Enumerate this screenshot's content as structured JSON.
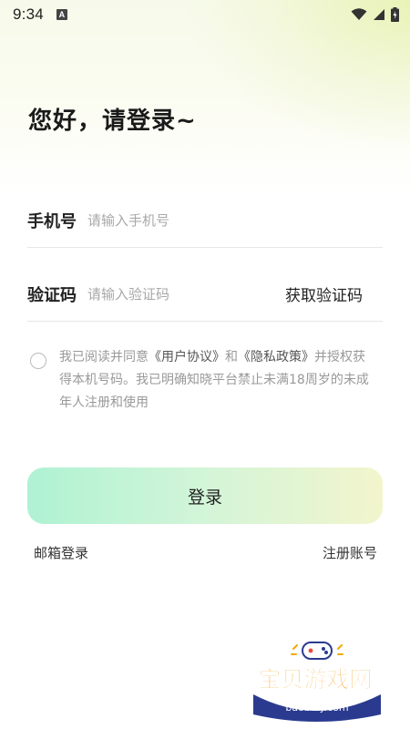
{
  "status_bar": {
    "time": "9:34",
    "notification_icon": "A"
  },
  "greeting": "您好，请登录~",
  "phone": {
    "label": "手机号",
    "placeholder": "请输入手机号",
    "value": ""
  },
  "code": {
    "label": "验证码",
    "placeholder": "请输入验证码",
    "value": "",
    "get_code_label": "获取验证码"
  },
  "agreement": {
    "checked": false,
    "text_before": "我已阅读并同意",
    "link_user": "《用户协议》",
    "text_and": "和",
    "link_privacy": "《隐私政策》",
    "text_after": "并授权获得本机号码。我已明确知晓平台禁止未满18周岁的未成年人注册和使用"
  },
  "login_button": "登录",
  "email_login": "邮箱登录",
  "register": "注册账号",
  "watermark": {
    "title": "宝贝游戏网",
    "url": "baobeiy.com"
  },
  "colors": {
    "button_start": "#aff2d3",
    "button_end": "#f2f5cc",
    "link_text": "#555555",
    "hint_text": "#a8a8a8"
  }
}
